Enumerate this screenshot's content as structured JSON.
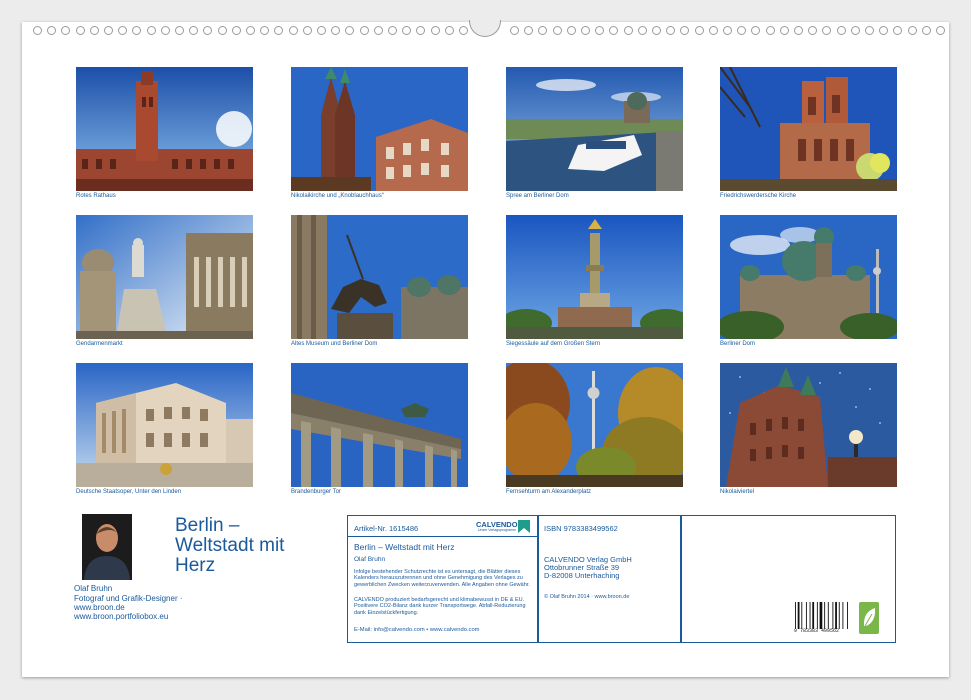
{
  "photos": [
    {
      "caption": "Rotes Rathaus",
      "scene": "red-town-hall"
    },
    {
      "caption": "Nikolaikirche und „Knoblauchhaus“",
      "scene": "twin-spires"
    },
    {
      "caption": "Spree am Berliner Dom",
      "scene": "river-dome"
    },
    {
      "caption": "Friedrichswerdersche Kirche",
      "scene": "gothic-church"
    },
    {
      "caption": "Gendarmenmarkt",
      "scene": "statue-square"
    },
    {
      "caption": "Altes Museum und Berliner Dom",
      "scene": "horse-statue"
    },
    {
      "caption": "Siegessäule auf dem Großen Stern",
      "scene": "victory-column"
    },
    {
      "caption": "Berliner Dom",
      "scene": "cathedral"
    },
    {
      "caption": "Deutsche Staatsoper, Unter den Linden",
      "scene": "opera"
    },
    {
      "caption": "Brandenburger Tor",
      "scene": "gate"
    },
    {
      "caption": "Fernsehturm am Alexanderplatz",
      "scene": "tv-tower"
    },
    {
      "caption": "Nikolaiviertel",
      "scene": "brick-church"
    }
  ],
  "author": {
    "name": "Olaf Bruhn",
    "desc": "Fotograf und Grafik-Designer · www.broon.de www.broon.portfoliobox.eu"
  },
  "title": "Berlin – Weltstadt mit Herz",
  "info": {
    "article": "Artikel-Nr. 1615486",
    "calvendo_logo": "CALVENDO",
    "calvendo_sub": "Unser Verlagsprogramm",
    "product_title": "Berlin – Weltstadt mit Herz",
    "product_author": "Olaf Bruhn",
    "copyright_text": "Infolge bestehender Schutzrechte ist es untersagt, die Blätter dieses Kalenders herauszutrennen und ohne Genehmigung des Verlages zu gewerblichen Zwecken weiterzuverwenden. Alle Angaben ohne Gewähr.",
    "eco_text": "CALVENDO produziert bedarfsgerecht und klimabewusst in DE & EU. Positivere CO2-Bilanz dank kurzer Transportwege. Abfall-Reduzierung dank Einzelstückfertigung.",
    "contact": "E-Mail: info@calvendo.com • www.calvendo.com",
    "isbn": "ISBN 9783383499562",
    "publisher": [
      "CALVENDO Verlag GmbH",
      "Ottobrunner Straße 39",
      "D-82008 Unterhaching"
    ],
    "photo_credit": "© Olaf Bruhn 2014 · www.broon.de",
    "barcode_text": "9 783383 499562"
  },
  "colors": {
    "accent": "#1a5a9c",
    "eco_green": "#7ab648"
  }
}
